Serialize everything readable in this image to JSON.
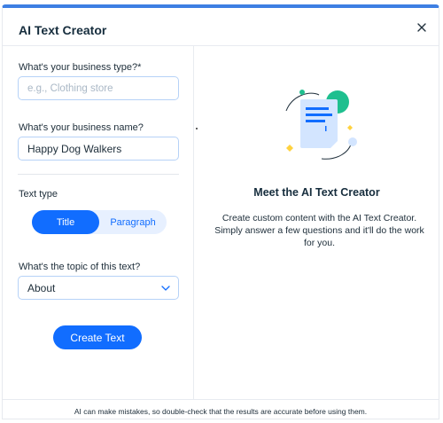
{
  "dialog": {
    "title": "AI Text Creator"
  },
  "form": {
    "business_type": {
      "label": "What's your business type?*",
      "placeholder": "e.g., Clothing store",
      "value": ""
    },
    "business_name": {
      "label": "What's your business name?",
      "value": "Happy Dog Walkers"
    },
    "text_type": {
      "label": "Text type",
      "options": [
        "Title",
        "Paragraph"
      ],
      "selected": "Title"
    },
    "topic": {
      "label": "What's the topic of this text?",
      "selected": "About"
    },
    "create_label": "Create Text"
  },
  "info": {
    "heading": "Meet the AI Text Creator",
    "description": "Create custom content with the AI Text Creator. Simply answer a few questions and it'll do the work for you."
  },
  "footer": {
    "disclaimer": "AI can make mistakes, so double-check that the results are accurate before using them."
  },
  "colors": {
    "accent": "#116dff",
    "accent_light": "#e7f0ff",
    "top_bar": "#3d7fe3",
    "illustration_green": "#1fbf8f",
    "illustration_yellow": "#ffd23f",
    "illustration_doc": "#d3e5ff"
  }
}
